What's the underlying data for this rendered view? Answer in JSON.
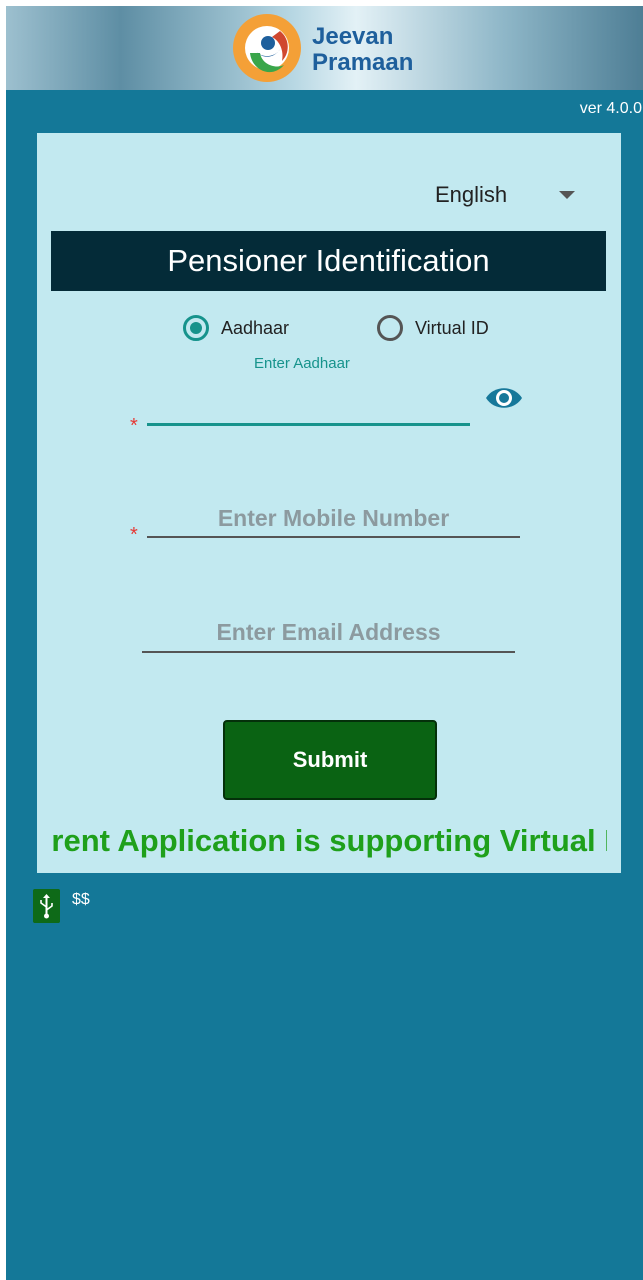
{
  "app": {
    "logo_line1": "Jeevan",
    "logo_line2": "Pramaan",
    "version": "ver 4.0.0"
  },
  "form": {
    "language": "English",
    "title": "Pensioner Identification",
    "radio_aadhaar": "Aadhaar",
    "radio_virtual_id": "Virtual ID",
    "selected_id_type": "Aadhaar",
    "aadhaar_label": "Enter Aadhaar",
    "aadhaar_value": "",
    "mobile_placeholder": "Enter Mobile Number",
    "email_placeholder": "Enter Email Address",
    "required_mark": "*",
    "submit_label": "Submit",
    "marquee_text": "Current Application is supporting Virtual ID"
  },
  "status": {
    "usb_text": "$$"
  },
  "colors": {
    "background": "#147898",
    "card": "#c2e9f0",
    "title_bar": "#042b38",
    "accent": "#16938c",
    "submit": "#0a6313",
    "marquee": "#1fa01b",
    "required": "#e53935"
  },
  "icons": [
    "jeevan-pramaan-logo",
    "eye-icon",
    "usb-icon",
    "dropdown-arrow-icon"
  ]
}
